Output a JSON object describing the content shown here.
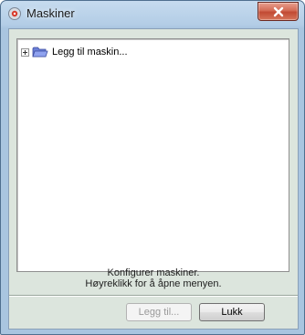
{
  "window": {
    "title": "Maskiner"
  },
  "tree": {
    "items": [
      {
        "label": "Legg til maskin..."
      }
    ]
  },
  "info": {
    "line1": "Konfigurer maskiner.",
    "line2": "Høyreklikk for å åpne menyen."
  },
  "buttons": {
    "add": "Legg til...",
    "close": "Lukk"
  },
  "icons": {
    "app": "machine-icon",
    "close": "close-icon",
    "folder": "folder-icon",
    "expander": "plus-expander-icon"
  },
  "colors": {
    "close_button": "#c94c35",
    "panel_bg": "#dce5dd"
  }
}
